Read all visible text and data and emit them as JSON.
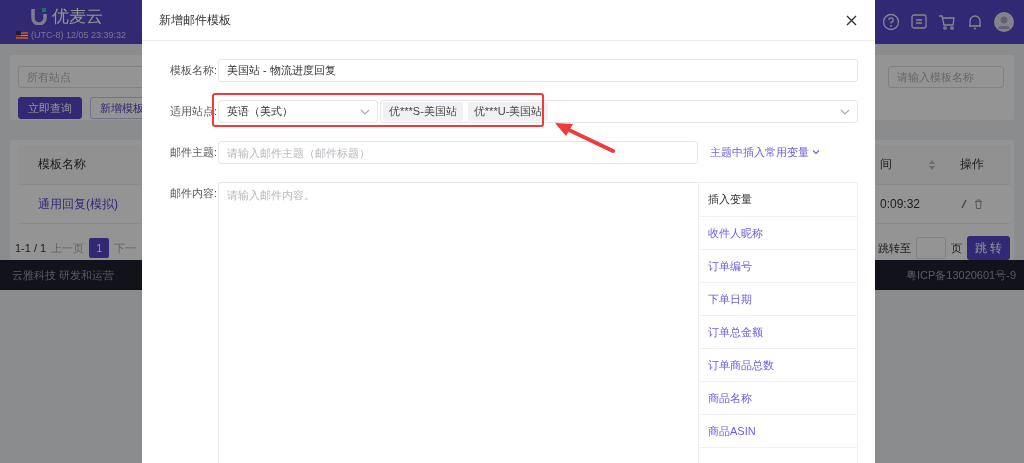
{
  "header": {
    "logo": "优麦云",
    "clock": "(UTC-8) 12/05 23:39:32"
  },
  "filters": {
    "site_placeholder": "所有站点",
    "search_button": "立即查询",
    "add_button": "新增模板",
    "name_placeholder": "请输入模板名称"
  },
  "table": {
    "columns": [
      "模板名称",
      "间",
      "操作"
    ],
    "rows": [
      {
        "name": "通用回复(模拟)",
        "time": "0:09:32"
      }
    ]
  },
  "pagination": {
    "range": "1-1 / 1",
    "prev": "上一页",
    "pages": [
      {
        "label": "1",
        "selected": true
      }
    ],
    "next": "下一",
    "jump_label": "跳转至",
    "page_unit": "页",
    "jump_button": "跳 转"
  },
  "footer": {
    "left": "云雅科技 研发和运营",
    "right": "粤ICP备13020601号-9"
  },
  "modal": {
    "title": "新增邮件模板",
    "fields": [
      {
        "kind": "text",
        "label": "模板名称:",
        "value": "美国站 - 物流进度回复"
      },
      {
        "kind": "site",
        "label": "适用站点:",
        "language": "英语（美式）",
        "tags": [
          "优***S-美国站",
          "优***U-美国站"
        ]
      },
      {
        "kind": "subject",
        "label": "邮件主题:",
        "placeholder": "请输入邮件主题（邮件标题）",
        "link": "主题中插入常用变量"
      },
      {
        "kind": "content",
        "label": "邮件内容:",
        "placeholder": "请输入邮件内容。",
        "variables_title": "插入变量",
        "variables": [
          "收件人昵称",
          "订单编号",
          "下单日期",
          "订单总金额",
          "订单商品总数",
          "商品名称",
          "商品ASIN"
        ]
      }
    ]
  }
}
